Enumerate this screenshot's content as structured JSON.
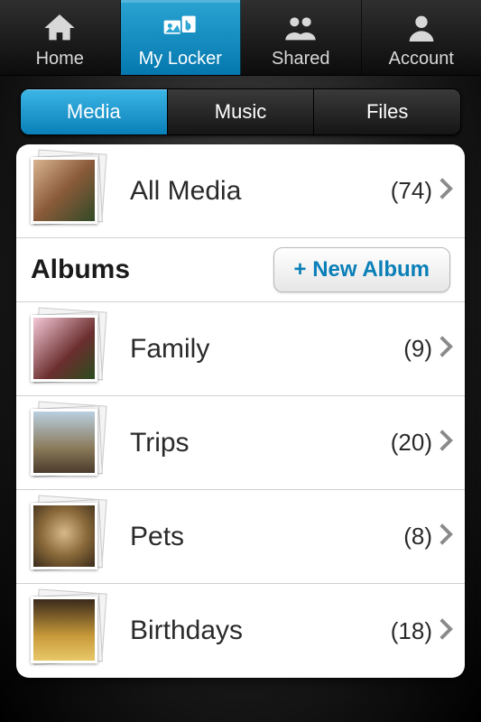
{
  "nav": {
    "items": [
      {
        "label": "Home",
        "icon": "home-icon",
        "active": false
      },
      {
        "label": "My Locker",
        "icon": "locker-icon",
        "active": true
      },
      {
        "label": "Shared",
        "icon": "shared-icon",
        "active": false
      },
      {
        "label": "Account",
        "icon": "account-icon",
        "active": false
      }
    ]
  },
  "tabs": {
    "items": [
      {
        "label": "Media",
        "active": true
      },
      {
        "label": "Music",
        "active": false
      },
      {
        "label": "Files",
        "active": false
      }
    ]
  },
  "all_media": {
    "label": "All Media",
    "count": "(74)"
  },
  "albums_section": {
    "title": "Albums",
    "new_button": "+ New Album"
  },
  "albums": [
    {
      "label": "Family",
      "count": "(9)"
    },
    {
      "label": "Trips",
      "count": "(20)"
    },
    {
      "label": "Pets",
      "count": "(8)"
    },
    {
      "label": "Birthdays",
      "count": "(18)"
    }
  ]
}
